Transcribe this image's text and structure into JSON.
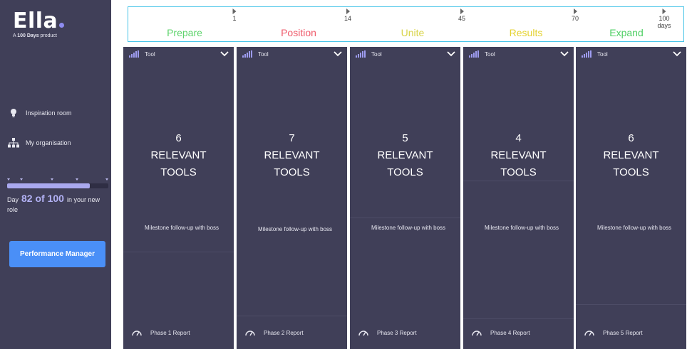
{
  "sidebar": {
    "logo": "Ella",
    "tagline_prefix": "A ",
    "tagline_bold": "100 Days",
    "tagline_suffix": " product",
    "nav": [
      {
        "label": "Inspiration room",
        "icon": "lightbulb-icon"
      },
      {
        "label": "My organisation",
        "icon": "org-chart-icon"
      }
    ],
    "progress": {
      "current_day": 82,
      "total_days": 100,
      "fraction": 0.82
    },
    "day_prefix": "Day",
    "day_value": "82 of 100",
    "day_suffix": "in your new role",
    "button_label": "Performance Manager"
  },
  "timeline": {
    "markers": [
      "1",
      "14",
      "45",
      "70",
      "100 days"
    ],
    "phases": [
      {
        "name": "Prepare",
        "color": "#5dd36b"
      },
      {
        "name": "Position",
        "color": "#ef5a6a"
      },
      {
        "name": "Unite",
        "color": "#d9d44a"
      },
      {
        "name": "Results",
        "color": "#e4d22f"
      },
      {
        "name": "Expand",
        "color": "#4fcf64"
      }
    ]
  },
  "columns": [
    {
      "tool_label": "Tool",
      "count": "6",
      "relevant": "RELEVANT",
      "tools": "TOOLS",
      "milestone": "Milestone follow-up with boss",
      "report": "Phase 1 Report"
    },
    {
      "tool_label": "Tool",
      "count": "7",
      "relevant": "RELEVANT",
      "tools": "TOOLS",
      "milestone": "Milestone follow-up with boss",
      "report": "Phase 2 Report"
    },
    {
      "tool_label": "Tool",
      "count": "5",
      "relevant": "RELEVANT",
      "tools": "TOOLS",
      "milestone": "Milestone follow-up with boss",
      "report": "Phase 3 Report"
    },
    {
      "tool_label": "Tool",
      "count": "4",
      "relevant": "RELEVANT",
      "tools": "TOOLS",
      "milestone": "Milestone follow-up with boss",
      "report": "Phase 4 Report"
    },
    {
      "tool_label": "Tool",
      "count": "6",
      "relevant": "RELEVANT",
      "tools": "TOOLS",
      "milestone": "Milestone follow-up with boss",
      "report": "Phase 5 Report"
    }
  ]
}
